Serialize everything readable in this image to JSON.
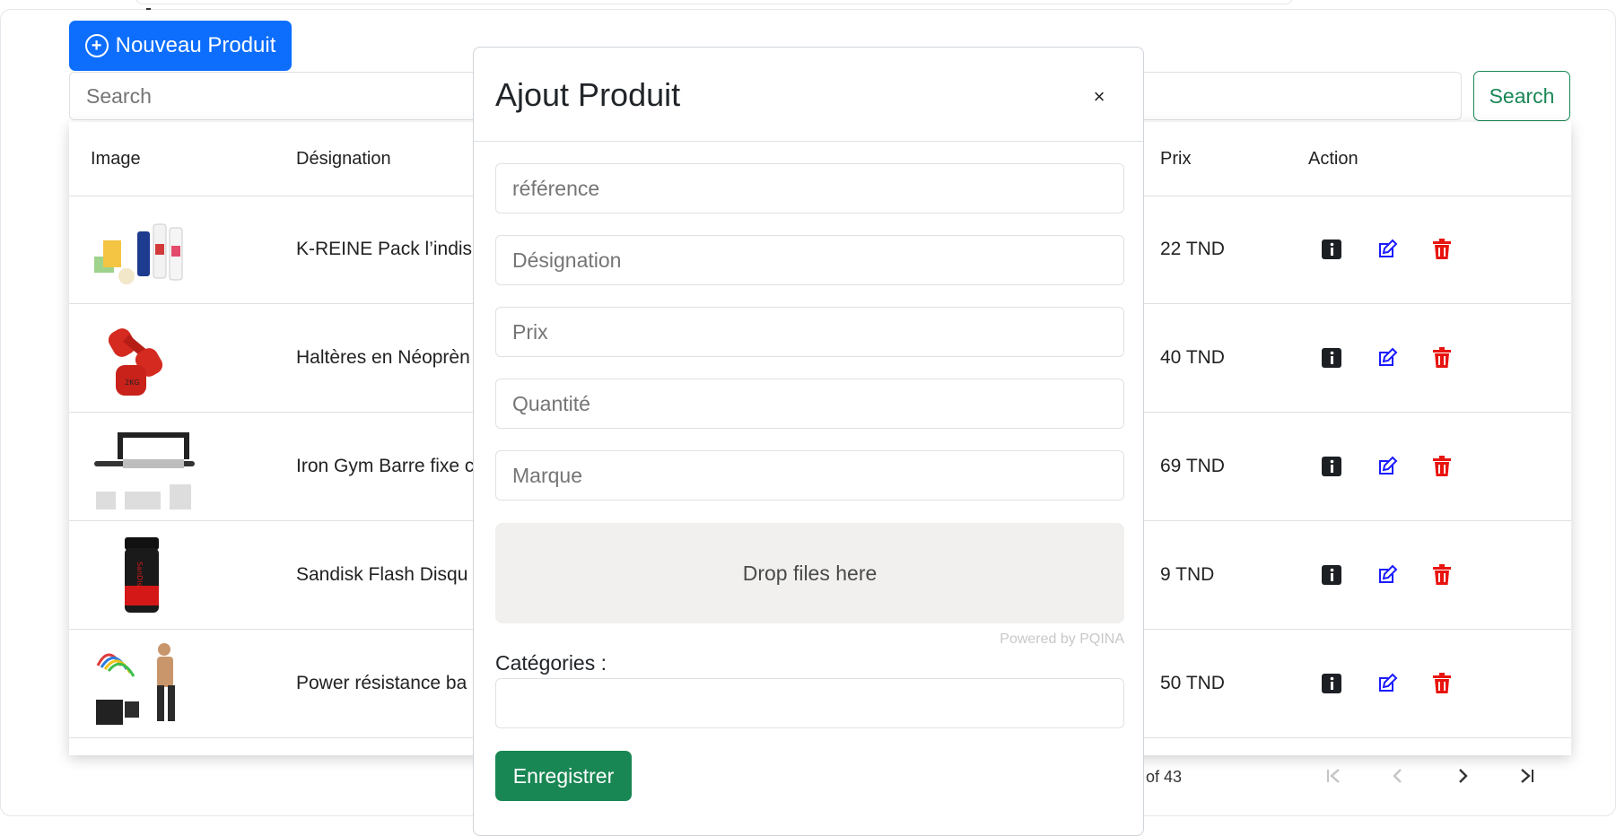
{
  "toolbar": {
    "new_product_label": "Nouveau Produit",
    "search_placeholder": "Search",
    "search_button": "Search"
  },
  "table": {
    "headers": [
      "Image",
      "Désignation",
      "Prix",
      "Action"
    ],
    "rows": [
      {
        "designation": "K-REINE Pack l’indis",
        "price": "22 TND"
      },
      {
        "designation": "Haltères en Néoprèn",
        "price": "40 TND"
      },
      {
        "designation": "Iron Gym Barre fixe c",
        "price": "69 TND"
      },
      {
        "designation": "Sandisk Flash Disqu",
        "price": "9 TND"
      },
      {
        "designation": "Power résistance ba",
        "price": "50 TND"
      }
    ]
  },
  "pagination": {
    "range": "1 – 5 of 43"
  },
  "modal": {
    "title": "Ajout Produit",
    "close": "×",
    "fields": {
      "reference": "référence",
      "designation": "Désignation",
      "prix": "Prix",
      "quantite": "Quantité",
      "marque": "Marque"
    },
    "dropzone": "Drop files here",
    "powered_by": "Powered by PQINA",
    "categories_label": "Catégories :",
    "save": "Enregistrer"
  },
  "colors": {
    "primary": "#0d6efd",
    "success": "#198754",
    "info_icon": "#1c1f24",
    "edit_icon": "#1a1aff",
    "delete_icon": "#e8140f"
  }
}
